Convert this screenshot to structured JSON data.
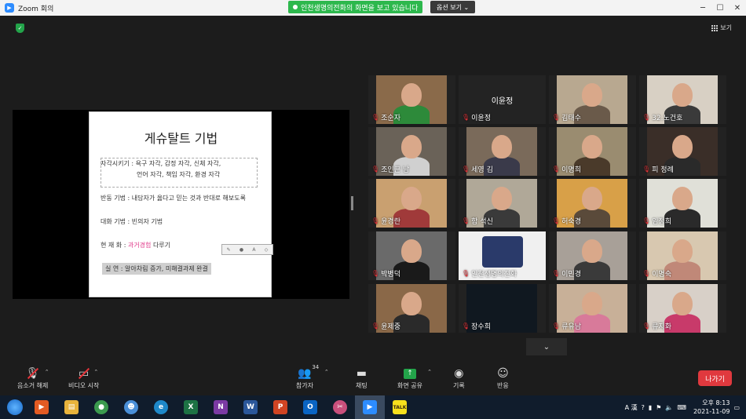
{
  "window": {
    "title": "Zoom 회의",
    "share_banner": "인천생명의전화의 화면을 보고 있습니다",
    "view_options": "옵션 보기 ⌄",
    "view_button": "보기"
  },
  "slide": {
    "title": "게슈탈트 기법",
    "lines": [
      "자각시키기 : 욕구 자각, 감정 자각, 신체 자각,",
      "언어 자각, 책임 자각, 환경 자각",
      "반동 기법 : 내담자가 옳다고 믿는 것과 반대로 해보도록",
      "대화 기법 : 빈의자 기법",
      "현 재 화 : ",
      "과거경험",
      " 다루기",
      "실        연 : 알아차림 증가, 미해결과제 완결"
    ]
  },
  "participants": [
    {
      "name": "조순자",
      "name_only": false
    },
    {
      "name": "이윤정",
      "name_only": true,
      "center_label": "이윤정"
    },
    {
      "name": "김태수",
      "name_only": false
    },
    {
      "name": "32.노건호",
      "name_only": false
    },
    {
      "name": "조인근 남",
      "name_only": false
    },
    {
      "name": "세영 김",
      "name_only": false
    },
    {
      "name": "이명희",
      "name_only": false
    },
    {
      "name": "피 정례",
      "name_only": false
    },
    {
      "name": "윤경란",
      "name_only": false
    },
    {
      "name": "함 석신",
      "name_only": false
    },
    {
      "name": "허숙경",
      "name_only": false
    },
    {
      "name": "임정희",
      "name_only": false
    },
    {
      "name": "박병덕",
      "name_only": false
    },
    {
      "name": "인천생명의전화",
      "name_only": false,
      "active": true
    },
    {
      "name": "이민경",
      "name_only": false
    },
    {
      "name": "이명숙",
      "name_only": false
    },
    {
      "name": "윤제중",
      "name_only": false
    },
    {
      "name": "장수희",
      "name_only": false
    },
    {
      "name": "류유남",
      "name_only": false
    },
    {
      "name": "류지화",
      "name_only": false
    }
  ],
  "toolbar": {
    "mute": "음소거 해제",
    "video": "비디오 시작",
    "participants": "참가자",
    "participant_count": "34",
    "chat": "채팅",
    "share": "화면 공유",
    "record": "기록",
    "reactions": "반응",
    "leave": "나가기"
  },
  "taskbar": {
    "time": "오후 8:13",
    "date": "2021-11-09",
    "ime": "A 漢"
  },
  "colors": {
    "share_green": "#2db84d",
    "mic_red": "#e5343a",
    "leave_red": "#e0393e",
    "active_outline": "#e4df2c"
  }
}
